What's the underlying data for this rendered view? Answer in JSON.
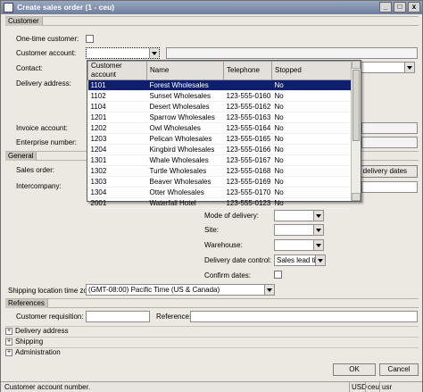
{
  "window": {
    "title": "Create sales order (1 - ceu)",
    "buttons": [
      "_",
      "□",
      "x"
    ]
  },
  "customer": {
    "header": "Customer",
    "one_time_label": "One-time customer:",
    "account_label": "Customer account:",
    "contact_label": "Contact:",
    "delivery_address_label": "Delivery address:",
    "invoice_account_label": "Invoice account:",
    "enterprise_number_label": "Enterprise number:"
  },
  "lookup": {
    "columns": [
      "Customer account",
      "Name",
      "Telephone",
      "Stopped"
    ],
    "rows": [
      {
        "account": "1101",
        "name": "Forest Wholesales",
        "phone": "",
        "stopped": "No"
      },
      {
        "account": "1102",
        "name": "Sunset Wholesales",
        "phone": "123-555-0160",
        "stopped": "No"
      },
      {
        "account": "1104",
        "name": "Desert Wholesales",
        "phone": "123-555-0162",
        "stopped": "No"
      },
      {
        "account": "1201",
        "name": "Sparrow Wholesales",
        "phone": "123-555-0163",
        "stopped": "No"
      },
      {
        "account": "1202",
        "name": "Owl Wholesales",
        "phone": "123-555-0164",
        "stopped": "No"
      },
      {
        "account": "1203",
        "name": "Pelican Wholesales",
        "phone": "123-555-0165",
        "stopped": "No"
      },
      {
        "account": "1204",
        "name": "Kingbird Wholesales",
        "phone": "123-555-0166",
        "stopped": "No"
      },
      {
        "account": "1301",
        "name": "Whale Wholesales",
        "phone": "123-555-0167",
        "stopped": "No"
      },
      {
        "account": "1302",
        "name": "Turtle Wholesales",
        "phone": "123-555-0168",
        "stopped": "No"
      },
      {
        "account": "1303",
        "name": "Beaver Wholesales",
        "phone": "123-555-0169",
        "stopped": "No"
      },
      {
        "account": "1304",
        "name": "Otter Wholesales",
        "phone": "123-555-0170",
        "stopped": "No"
      },
      {
        "account": "2001",
        "name": "Waterfall Hotel",
        "phone": "123-555-0123",
        "stopped": "No"
      }
    ],
    "selected_index": 0
  },
  "general": {
    "header": "General",
    "sales_order_label": "Sales order:",
    "intercompany_label": "Intercompany:",
    "delivery_dates_button": "ce delivery dates",
    "mode_of_delivery_label": "Mode of delivery:",
    "site_label": "Site:",
    "warehouse_label": "Warehouse:",
    "delivery_date_control_label": "Delivery date control:",
    "delivery_date_control_value": "Sales lead time",
    "confirm_dates_label": "Confirm dates:",
    "time_zone_label": "Shipping location time zone:",
    "time_zone_value": "(GMT-08:00) Pacific Time (US & Canada)"
  },
  "references": {
    "header": "References",
    "customer_requisition_label": "Customer requisition:",
    "reference_label": "Reference:"
  },
  "collapsed_sections": [
    "Delivery address",
    "Shipping",
    "Administration"
  ],
  "actions": {
    "ok": "OK",
    "cancel": "Cancel"
  },
  "status": {
    "message": "Customer account number.",
    "currency": "USD",
    "company": "ceu",
    "user": "usr"
  }
}
